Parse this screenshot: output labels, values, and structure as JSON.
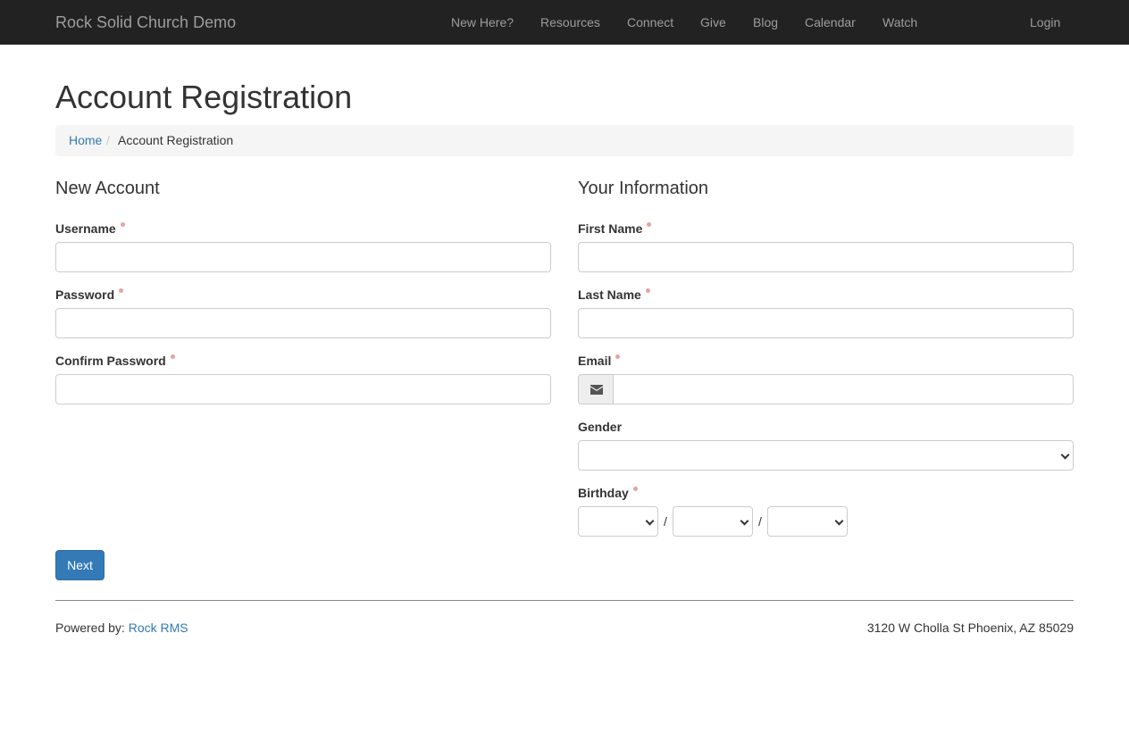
{
  "navbar": {
    "brand": "Rock Solid Church Demo",
    "items": [
      {
        "label": "New Here?"
      },
      {
        "label": "Resources"
      },
      {
        "label": "Connect"
      },
      {
        "label": "Give"
      },
      {
        "label": "Blog"
      },
      {
        "label": "Calendar"
      },
      {
        "label": "Watch"
      }
    ],
    "login": "Login"
  },
  "page": {
    "title": "Account Registration"
  },
  "breadcrumb": {
    "home": "Home",
    "separator": "/",
    "current": "Account Registration"
  },
  "new_account": {
    "heading": "New Account",
    "username_label": "Username",
    "password_label": "Password",
    "confirm_password_label": "Confirm Password"
  },
  "your_information": {
    "heading": "Your Information",
    "first_name_label": "First Name",
    "last_name_label": "Last Name",
    "email_label": "Email",
    "email_icon": "envelope-icon",
    "gender_label": "Gender",
    "birthday_label": "Birthday",
    "birthday_separator": "/"
  },
  "actions": {
    "next_label": "Next"
  },
  "footer": {
    "powered_by": "Powered by:",
    "powered_link": "Rock RMS",
    "address": "3120 W Cholla St Phoenix, AZ 85029"
  },
  "colors": {
    "navbar_bg": "#222222",
    "navbar_text": "#9d9d9d",
    "link": "#337ab7",
    "primary_button": "#337ab7",
    "required_dot": "#e8a1a1",
    "breadcrumb_bg": "#f5f5f5"
  }
}
